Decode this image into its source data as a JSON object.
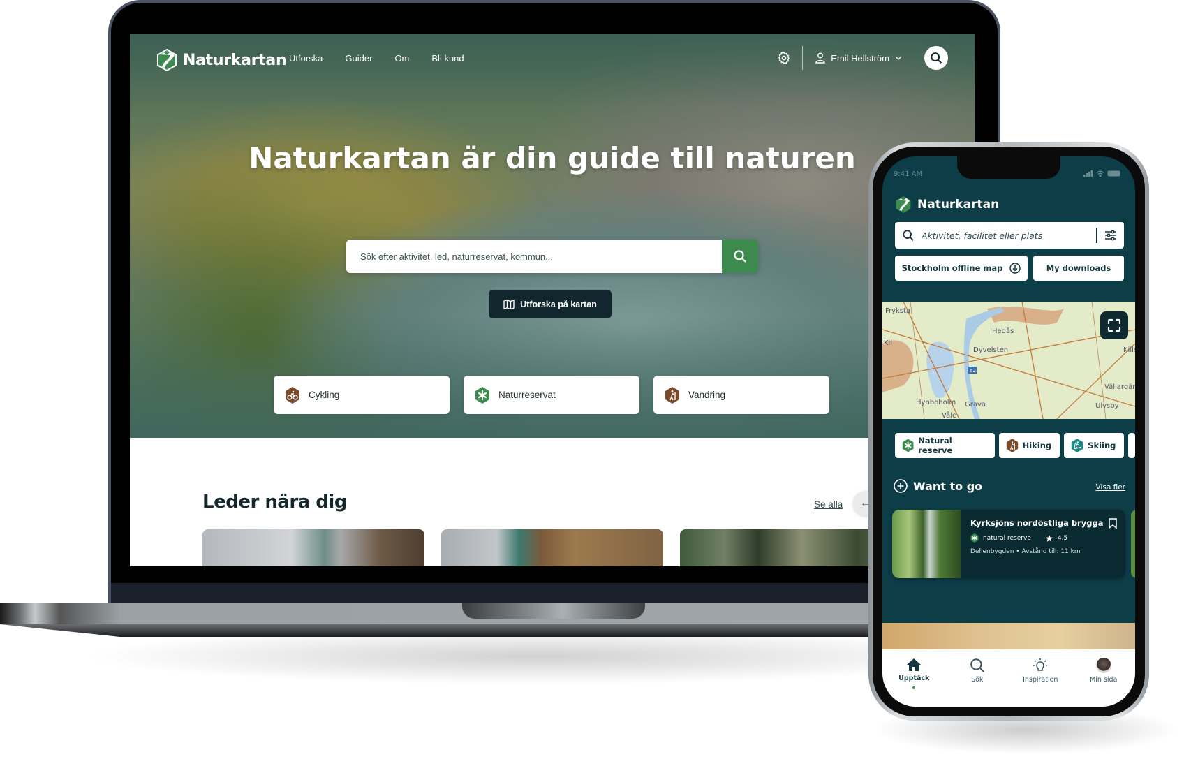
{
  "desktop": {
    "brand": "Naturkartan",
    "nav": {
      "links": [
        "Utforska",
        "Guider",
        "Om",
        "Bli kund"
      ],
      "user_name": "Emil Hellström",
      "icons": {
        "settings": "gear-icon",
        "user": "user-icon",
        "dropdown": "chevron-down-icon",
        "search": "search-icon"
      }
    },
    "hero": {
      "title": "Naturkartan är din guide till naturen",
      "search_placeholder": "Sök efter aktivitet, led, naturreservat, kommun...",
      "map_button": "Utforska på kartan",
      "categories": [
        {
          "label": "Cykling",
          "icon": "cycling-icon",
          "color": "#7a4a2a"
        },
        {
          "label": "Naturreservat",
          "icon": "nature-reserve-icon",
          "color": "#3c8a4e"
        },
        {
          "label": "Vandring",
          "icon": "hiking-icon",
          "color": "#7a4a2a"
        }
      ]
    },
    "trails_section": {
      "title": "Leder nära dig",
      "see_all": "Se alla",
      "prev_arrow": "←"
    }
  },
  "mobile": {
    "status_time": "9:41 AM",
    "brand": "Naturkartan",
    "search_placeholder": "Aktivitet, facilitet eller plats",
    "buttons": {
      "offline_map": "Stockholm offline map",
      "downloads": "My downloads"
    },
    "map_labels": [
      "Fryksta",
      "Hedås",
      "Kil",
      "Dyvelsten",
      "62",
      "Hynboholm",
      "Grava",
      "Våle",
      "Ulvsby",
      "Vällargärd",
      "Kills"
    ],
    "chips": [
      {
        "label": "Natural reserve",
        "icon": "nature-reserve-icon",
        "color": "#3c8a4e"
      },
      {
        "label": "Hiking",
        "icon": "hiking-icon",
        "color": "#7a4a2a"
      },
      {
        "label": "Skiing",
        "icon": "skiing-icon",
        "color": "#1f8a86"
      }
    ],
    "want_to_go": {
      "title": "Want to go",
      "more": "Visa fler",
      "card": {
        "title": "Kyrksjöns nordöstliga brygga",
        "category": "natural reserve",
        "rating": "4,5",
        "area": "Dellenbygden",
        "distance": "Avstånd till: 11 km"
      }
    },
    "tabs": [
      {
        "label": "Upptäck",
        "icon": "home-icon",
        "active": true
      },
      {
        "label": "Sök",
        "icon": "search-icon",
        "active": false
      },
      {
        "label": "Inspiration",
        "icon": "lightbulb-icon",
        "active": false
      },
      {
        "label": "Min sida",
        "icon": "avatar",
        "active": false
      }
    ]
  },
  "colors": {
    "brand_green": "#3c8a4e",
    "mobile_bg": "#0d3d47",
    "dark_button": "#12272d",
    "brown": "#7a4a2a"
  }
}
